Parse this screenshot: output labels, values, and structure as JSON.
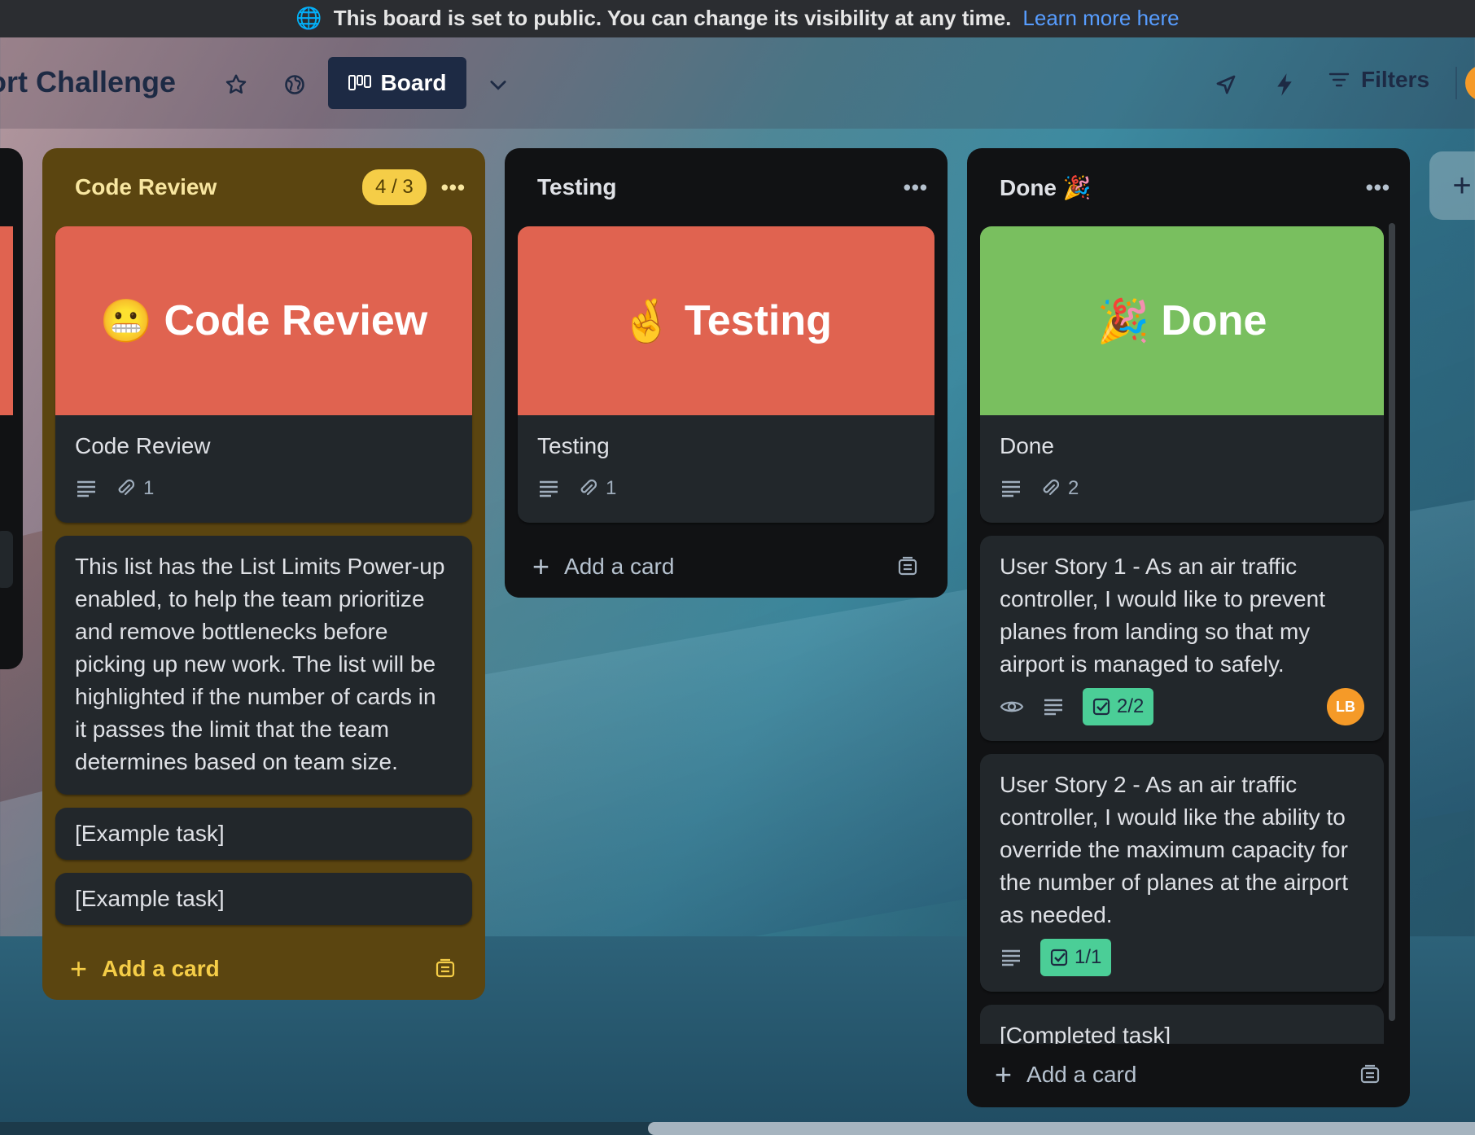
{
  "banner": {
    "text": "This board is set to public. You can change its visibility at any time.",
    "link": "Learn more here"
  },
  "header": {
    "board_title": "ort Challenge",
    "view_label": "Board",
    "filters_label": "Filters"
  },
  "lists": [
    {
      "title": "Code Review",
      "limit_badge": "4 / 3",
      "cover_card": {
        "cover_emoji": "😬",
        "cover_text": "Code Review",
        "title": "Code Review",
        "attachments": "1"
      },
      "cards": [
        "This list has the List Limits Power-up enabled, to help the team prioritize and remove bottlenecks before picking up new work. The list will be highlighted if the number of cards in it passes the limit that the team determines based on team size.",
        "[Example task]",
        "[Example task]"
      ],
      "add_card": "Add a card"
    },
    {
      "title": "Testing",
      "cover_card": {
        "cover_emoji": "🤞",
        "cover_text": "Testing",
        "title": "Testing",
        "attachments": "1"
      },
      "add_card": "Add a card"
    },
    {
      "title": "Done 🎉",
      "cover_card": {
        "cover_emoji": "🎉",
        "cover_text": "Done",
        "title": "Done",
        "attachments": "2"
      },
      "cards": [
        {
          "title": "User Story 1 - As an air traffic controller, I would like to prevent planes from landing so that my airport is managed to safely.",
          "checklist": "2/2",
          "member": "LB"
        },
        {
          "title": "User Story 2 - As an air traffic controller, I would like the ability to override the maximum capacity for the number of planes at the airport as needed.",
          "checklist": "1/1"
        },
        {
          "title": "[Completed task]"
        }
      ],
      "add_card": "Add a card"
    }
  ],
  "colors": {
    "cover_red": "#e06350",
    "cover_green": "#79bf5f",
    "list_limit_bg": "#5b4510",
    "checklist_complete": "#4bce97",
    "member_avatar": "#f59a28"
  },
  "icons": [
    "globe-icon",
    "star-icon",
    "board-icon",
    "chevron-down-icon",
    "rocket-icon",
    "lightning-icon",
    "filter-icon",
    "description-icon",
    "attachment-icon",
    "watch-icon",
    "checklist-icon",
    "template-icon",
    "plus-icon",
    "more-icon"
  ]
}
